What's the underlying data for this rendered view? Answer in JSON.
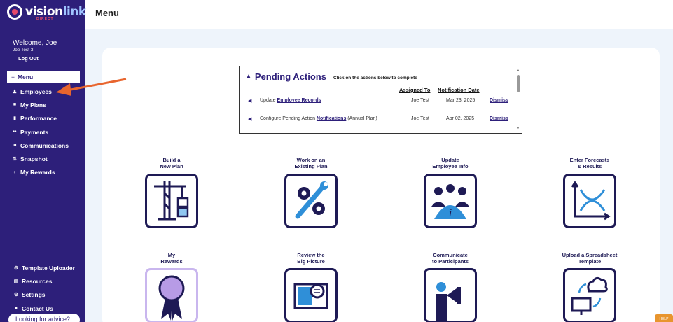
{
  "brand": {
    "name_part1": "vision",
    "name_part2": "link",
    "sub": "DIRECT"
  },
  "user": {
    "welcome": "Welcome, Joe",
    "name": "Joe Test 3",
    "logout": "Log Out"
  },
  "sidebar": {
    "active": {
      "icon": "≡",
      "label": "Menu"
    },
    "items": [
      {
        "icon": "♟",
        "label": "Employees"
      },
      {
        "icon": "■",
        "label": "My Plans"
      },
      {
        "icon": "▮",
        "label": "Performance"
      },
      {
        "icon": "••",
        "label": "Payments"
      },
      {
        "icon": "◄",
        "label": "Communications"
      },
      {
        "icon": "⇅",
        "label": "Snapshot"
      },
      {
        "icon": "♀",
        "label": "My Rewards"
      }
    ],
    "bottom_items": [
      {
        "icon": "⚙",
        "label": "Template Uploader"
      },
      {
        "icon": "▤",
        "label": "Resources"
      },
      {
        "icon": "⚙",
        "label": "Settings"
      },
      {
        "icon": "●",
        "label": "Contact Us"
      }
    ],
    "advice": "Looking for advice?"
  },
  "header": {
    "title": "Menu"
  },
  "pending": {
    "title": "Pending Actions",
    "subtitle": "Click on the actions below to complete",
    "col_assigned": "Assigned To",
    "col_date": "Notification Date",
    "rows": [
      {
        "prefix": "Update ",
        "link": "Employee Records",
        "suffix": "",
        "who": "Joe Test",
        "date": "Mar 23, 2025",
        "action": "Dismiss"
      },
      {
        "prefix": "Configure Pending Action ",
        "link": "Notifications",
        "suffix": " (Annual Plan)",
        "who": "Joe Test",
        "date": "Apr 02, 2025",
        "action": "Dismiss"
      }
    ]
  },
  "tiles": [
    {
      "line1": "Build a",
      "line2": "New Plan"
    },
    {
      "line1": "Work on an",
      "line2": "Existing Plan"
    },
    {
      "line1": "Update",
      "line2": "Employee Info"
    },
    {
      "line1": "Enter Forecasts",
      "line2": "& Results"
    },
    {
      "line1": "My",
      "line2": "Rewards"
    },
    {
      "line1": "Review the",
      "line2": "Big Picture"
    },
    {
      "line1": "Communicate",
      "line2": "to Participants"
    },
    {
      "line1": "Upload a Spreadsheet",
      "line2": "Template"
    }
  ],
  "help": {
    "label": "HELP"
  },
  "colors": {
    "sidebar": "#2d1f7a",
    "accent": "#e8652e",
    "tile_border": "#1e1a55"
  }
}
